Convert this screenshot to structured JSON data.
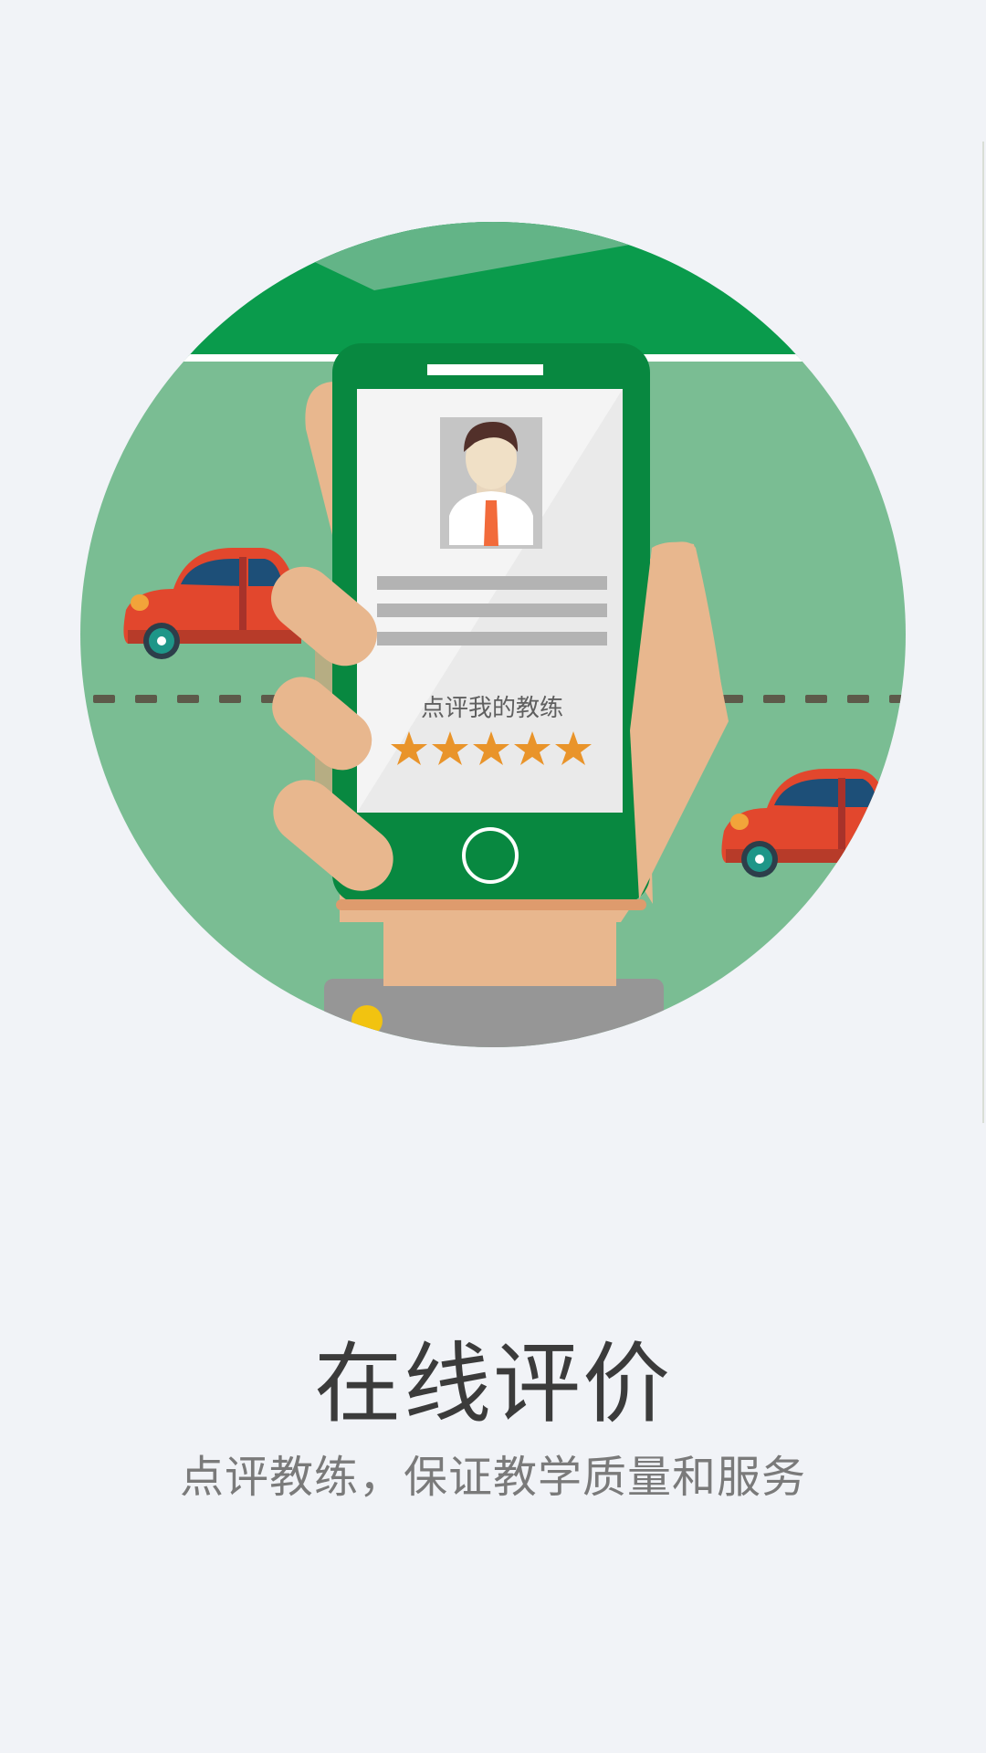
{
  "illustration": {
    "phone_card_caption": "点评我的教练",
    "rating_stars": 5
  },
  "title": "在线评价",
  "subtitle": "点评教练，保证教学质量和服务",
  "colors": {
    "background": "#f1f3f7",
    "circle_green": "#7abd93",
    "dark_green": "#0a9b4c",
    "phone_green": "#088840",
    "star_orange": "#e9942a",
    "car_red": "#e2472d"
  }
}
